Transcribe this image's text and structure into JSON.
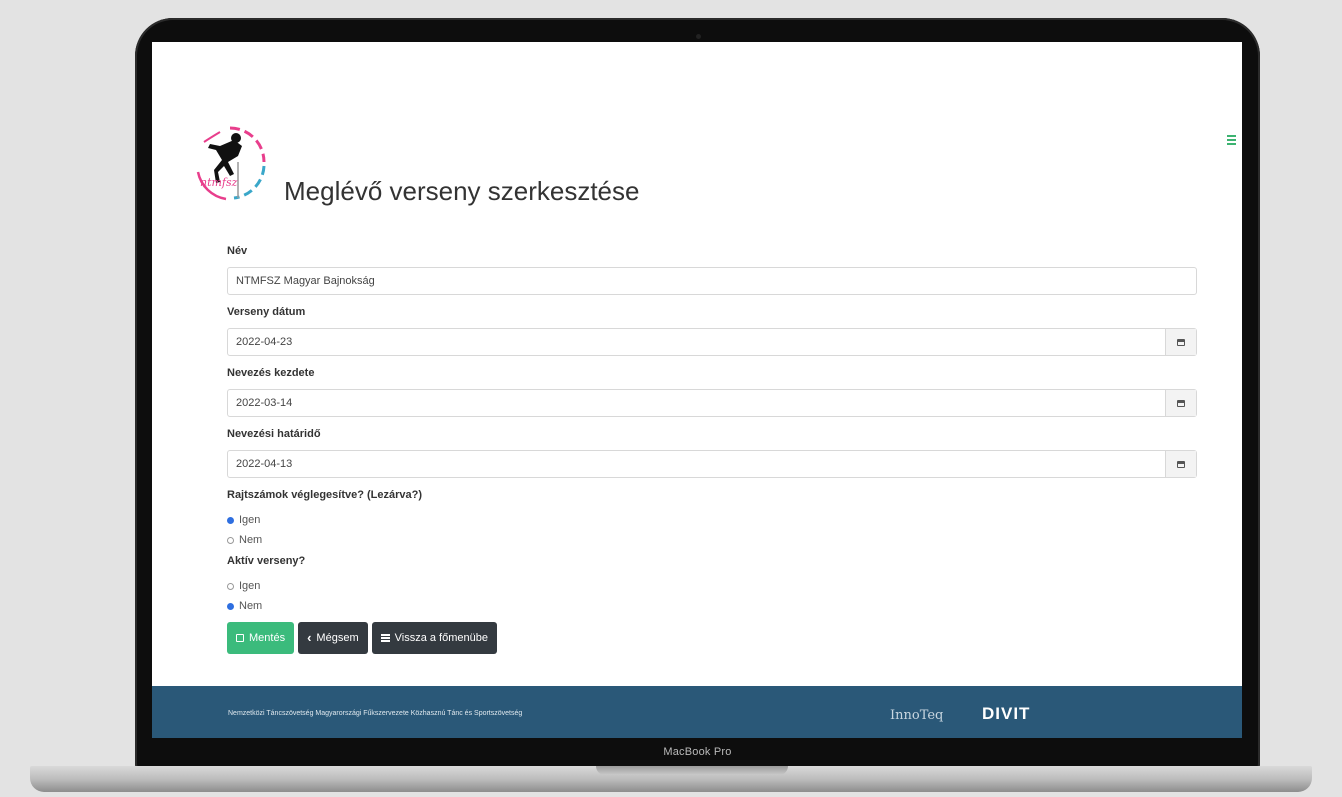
{
  "device": {
    "label": "MacBook Pro"
  },
  "page": {
    "title": "Meglévő verseny szerkesztése"
  },
  "form": {
    "name": {
      "label": "Név",
      "value": "NTMFSZ Magyar Bajnokság"
    },
    "date": {
      "label": "Verseny dátum",
      "value": "2022-04-23"
    },
    "entry_start": {
      "label": "Nevezés kezdete",
      "value": "2022-03-14"
    },
    "entry_deadline": {
      "label": "Nevezési határidő",
      "value": "2022-04-13"
    },
    "bib_locked": {
      "label": "Rajtszámok véglegesítve? (Lezárva?)",
      "options": [
        "Igen",
        "Nem"
      ],
      "selected": "Igen"
    },
    "active": {
      "label": "Aktív verseny?",
      "options": [
        "Igen",
        "Nem"
      ],
      "selected": "Nem"
    }
  },
  "buttons": {
    "save": "Mentés",
    "cancel": "Mégsem",
    "back": "Vissza a főmenübe"
  },
  "footer": {
    "text": "Nemzetközi Táncszövetség Magyarországi Fűkszervezete Közhasznú Tánc és Sportszövetség",
    "partner1": "InnoTeq",
    "partner2": "DIVIT"
  },
  "colors": {
    "primary_green": "#3bbb7c",
    "dark_button": "#343a40",
    "footer_bg": "#2a5878",
    "radio_checked": "#2f6fe0"
  }
}
